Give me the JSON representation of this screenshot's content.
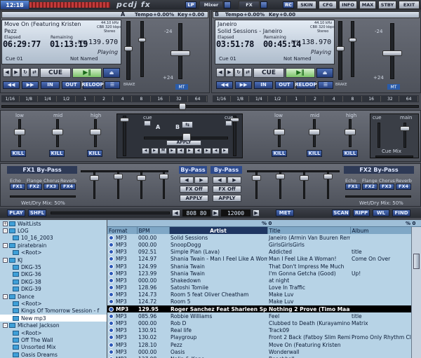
{
  "app": {
    "clock": "12:18",
    "brand": "pcdj fx"
  },
  "topbar": {
    "lp": "LP",
    "mixer": "Mixer",
    "fx": "FX",
    "rc": "RC",
    "skin": "SKIN",
    "cfg": "CFG",
    "info": "INFO",
    "max": "MAX",
    "stby": "STBY",
    "exit": "EXIT"
  },
  "deckA": {
    "letter": "A",
    "tempo_label": "Tempo",
    "tempo": "+0.00%",
    "key_label": "Key",
    "key": "+0.00",
    "title": "Move On (Featuring Kristen",
    "artist": "Pezz",
    "info1": "44.10 kHz",
    "info2": "CBR 320 kbps",
    "info3": "Stereo",
    "elapsed_label": "Elapsed",
    "remaining_label": "Remaining",
    "bpm_label": "BPM",
    "elapsed": "06:29:77",
    "remaining": "01:13:19",
    "bpm": "139.970",
    "status": "Playing",
    "cue": "Cue 01",
    "named": "Not Named",
    "cue_btn": "CUE",
    "in": "IN",
    "out": "OUT",
    "reloop": "RELOOP",
    "mt": "MT",
    "brake": "BRAKE",
    "mix_label": "MIX",
    "rate": "+24",
    "ratm": "-24"
  },
  "deckB": {
    "letter": "B",
    "tempo_label": "Tempo",
    "tempo": "+0.00%",
    "key_label": "Key",
    "key": "+0.00",
    "title": "Janeiro",
    "artist": "Solid Sessions - Janeiro",
    "info1": "44.10 kHz",
    "info2": "CBR 320 kbps",
    "info3": "Stereo",
    "elapsed_label": "Elapsed",
    "remaining_label": "Remaining",
    "bpm_label": "BPM",
    "elapsed": "03:51:78",
    "remaining": "00:45:14",
    "bpm": "138.970",
    "status": "Playing",
    "cue": "Cue 01",
    "named": "Not Named",
    "cue_btn": "CUE",
    "in": "IN",
    "out": "OUT",
    "reloop": "RELOOP",
    "mt": "MT",
    "brake": "BRAKE",
    "rate": "+24",
    "ratm": "-24"
  },
  "beats": [
    "1/16",
    "1/8",
    "1/4",
    "1/2",
    "1",
    "2",
    "4",
    "8",
    "16",
    "32",
    "64"
  ],
  "eq": {
    "low": "low",
    "mid": "mid",
    "high": "high",
    "kill": "KILL",
    "cue": "cue",
    "main": "main",
    "cuemix": "Cue Mix",
    "a": "A",
    "b": "B",
    "apply": "APPLY",
    "mixer_bar": "M"
  },
  "fx1": {
    "title": "FX1 By-Pass",
    "names": [
      "Echo",
      "Flange",
      "Chorus",
      "Reverb"
    ],
    "btns": [
      "FX1",
      "FX2",
      "FX3",
      "FX4"
    ],
    "wet": "Wet/Dry Mix: 50%"
  },
  "fx2": {
    "title": "FX2 By-Pass",
    "names": [
      "Echo",
      "Flange",
      "Chorus",
      "Reverb"
    ],
    "btns": [
      "FX1",
      "FX2",
      "FX3",
      "FX4"
    ],
    "wet": "Wet/Dry Mix: 50%"
  },
  "fxmid": {
    "bypass1": "By-Pass",
    "bypass2": "By-Pass",
    "fxoff": "FX Off",
    "apply": "APPLY"
  },
  "bottombar": {
    "play": "PLAY",
    "shfl": "SHFL",
    "bpm_field": "808 80",
    "counter": "12000",
    "met": "MET",
    "scan": "SCAN",
    "ripp": "RIPP",
    "wl": "WL",
    "find": "FIND",
    "pct": "% 0",
    "pct2": "% 0"
  },
  "tree": [
    {
      "label": "WaitLists",
      "level": 0,
      "pm": "+"
    },
    {
      "label": "LOG",
      "level": 0,
      "pm": "-"
    },
    {
      "label": "10_16_2003",
      "level": 1,
      "pm": ""
    },
    {
      "label": "piratebrain",
      "level": 0,
      "pm": "-"
    },
    {
      "label": "<Root>",
      "level": 1,
      "pm": ""
    },
    {
      "label": "KJ",
      "level": 0,
      "pm": "-"
    },
    {
      "label": "DKG-35",
      "level": 1,
      "pm": ""
    },
    {
      "label": "DKG-36",
      "level": 1,
      "pm": ""
    },
    {
      "label": "DKG-38",
      "level": 1,
      "pm": ""
    },
    {
      "label": "DKG-39",
      "level": 1,
      "pm": ""
    },
    {
      "label": "Dance",
      "level": 0,
      "pm": "-"
    },
    {
      "label": "<Root>",
      "level": 1,
      "pm": ""
    },
    {
      "label": "Kings Of Tomorrow Session - f",
      "level": 1,
      "pm": ""
    },
    {
      "label": "New mp3",
      "level": 1,
      "pm": "",
      "selected": true
    },
    {
      "label": "Michael Jackson",
      "level": 0,
      "pm": "-"
    },
    {
      "label": "<Root>",
      "level": 1,
      "pm": ""
    },
    {
      "label": "Off The Wall",
      "level": 1,
      "pm": ""
    },
    {
      "label": "Unsorted Mix",
      "level": 1,
      "pm": ""
    },
    {
      "label": "Oasis Dreams",
      "level": 1,
      "pm": ""
    }
  ],
  "table": {
    "headers": [
      "Format",
      "BPM",
      "Artist",
      "Title",
      "Album"
    ],
    "rows": [
      [
        "MP3",
        "000.00",
        "Solid Sessions",
        "Janeiro (Armin Van Buuren Remi...",
        ""
      ],
      [
        "MP3",
        "000.00",
        "SnoopDogg",
        "GirlsGirlsGirls",
        ""
      ],
      [
        "MP3",
        "092.51",
        "Simple Plan (Lava)",
        "Addicted",
        "title"
      ],
      [
        "MP3",
        "124.97",
        "Shania Twain - Man I Feel Like A Wom...",
        "Man I Feel Like A Woman!",
        "Come On Over"
      ],
      [
        "MP3",
        "124.99",
        "Shania Twain",
        "That Don't Impress Me Much",
        ""
      ],
      [
        "MP3",
        "123.99",
        "Shania Twain",
        "I'm Gonna Getcha (Good)",
        "Up!"
      ],
      [
        "MP3",
        "000.00",
        "Shakedown",
        "at night",
        ""
      ],
      [
        "MP3",
        "128.96",
        "Satoshi Tomiie",
        "Love In Traffic",
        ""
      ],
      [
        "MP3",
        "124.73",
        "Room 5 feat Oliver Cheatham",
        "Make Luv",
        ""
      ],
      [
        "MP3",
        "124.72",
        "Room 5",
        "Make Luv",
        ""
      ],
      [
        "MP3",
        "129.95",
        "Roger Sanchez Feat Sharleen Spiteri - ...",
        "Nothing 2 Prove (Timo Maas Clu...",
        ""
      ],
      [
        "MP3",
        "085.96",
        "Robbie Williams",
        "Feel",
        "title"
      ],
      [
        "MP3",
        "000.00",
        "Rob D",
        "Clubbed to Death (Kurayamino M...",
        "Matrix"
      ],
      [
        "MP3",
        "130.91",
        "Real life",
        "Track09",
        ""
      ],
      [
        "MP3",
        "130.02",
        "Playgroup",
        "Front 2 Back (Fatboy Slim Remi",
        "Promo Only Rhythm Clu..."
      ],
      [
        "MP3",
        "128.10",
        "Pezz",
        "Move On (Featuring Kristen",
        ""
      ],
      [
        "MP3",
        "000.00",
        "Oasis",
        "Wonderwall",
        ""
      ],
      [
        "MP3",
        "127.98",
        "Nalin & Kane",
        "Beachball",
        ""
      ]
    ],
    "selected_row": 10
  },
  "colors": {
    "accent": "#2d4a8c",
    "list_bg": "#b7d3e6",
    "panel": "#5a5e68"
  }
}
